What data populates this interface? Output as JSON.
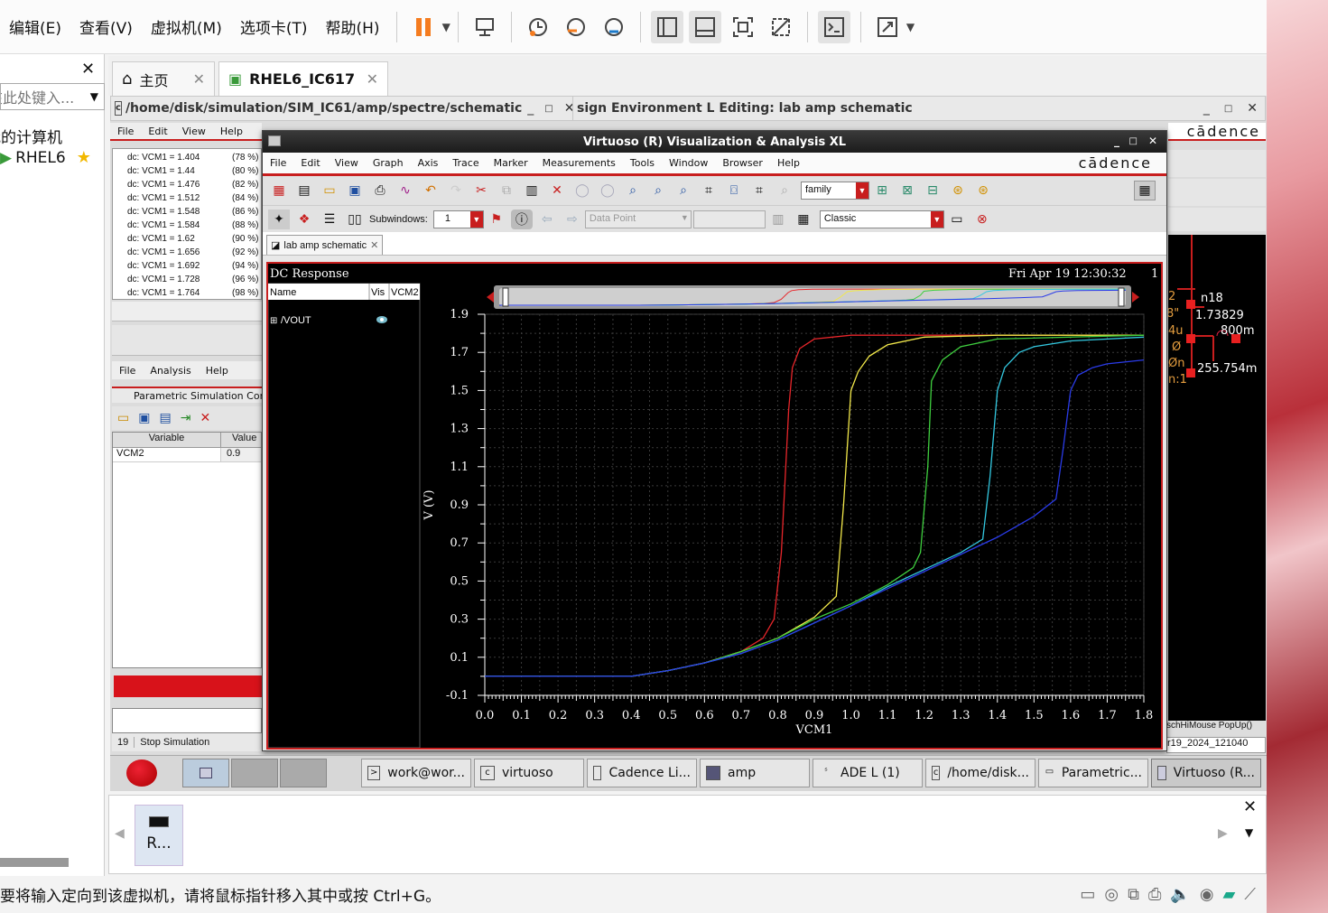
{
  "host": {
    "menu": [
      "编辑(E)",
      "查看(V)",
      "虚拟机(M)",
      "选项卡(T)",
      "帮助(H)"
    ],
    "tabs": [
      {
        "label": "主页"
      },
      {
        "label": "RHEL6_IC617"
      }
    ],
    "library": {
      "search_placeholder": "在此处键入...",
      "item1": "我的计算机",
      "item2": "RHEL6"
    },
    "status_text": "要将输入定向到该虚拟机，请将鼠标指针移入其中或按 Ctrl+G。",
    "thumb_label": "R..."
  },
  "ade": {
    "title": "/home/disk/simulation/SIM_IC61/amp/spectre/schematic",
    "menu": [
      "File",
      "Edit",
      "View",
      "Help"
    ],
    "rows": [
      {
        "label": "dc: VCM1 = 1.404",
        "pct": "(78 %)"
      },
      {
        "label": "dc: VCM1 = 1.44",
        "pct": "(80 %)"
      },
      {
        "label": "dc: VCM1 = 1.476",
        "pct": "(82 %)"
      },
      {
        "label": "dc: VCM1 = 1.512",
        "pct": "(84 %)"
      },
      {
        "label": "dc: VCM1 = 1.548",
        "pct": "(86 %)"
      },
      {
        "label": "dc: VCM1 = 1.584",
        "pct": "(88 %)"
      },
      {
        "label": "dc: VCM1 = 1.62",
        "pct": "(90 %)"
      },
      {
        "label": "dc: VCM1 = 1.656",
        "pct": "(92 %)"
      },
      {
        "label": "dc: VCM1 = 1.692",
        "pct": "(94 %)"
      },
      {
        "label": "dc: VCM1 = 1.728",
        "pct": "(96 %)"
      },
      {
        "label": "dc: VCM1 = 1.764",
        "pct": "(98 %)"
      }
    ]
  },
  "schematic": {
    "title": "sign Environment L Editing: lab amp schematic",
    "brand": "cādence",
    "labels": [
      "n18",
      "1.73829",
      "800m",
      "255.754m"
    ],
    "status1": "schHiMouse PopUp()",
    "status2": "r19_2024_121040"
  },
  "param": {
    "menu": [
      "File",
      "Analysis",
      "Help"
    ],
    "title": "Parametric Simulation Com",
    "col_variable": "Variable",
    "col_value": "Value",
    "var_name": "VCM2",
    "var_value": "0.9",
    "line_no": "19",
    "stop_label": "Stop Simulation"
  },
  "viva": {
    "title": "Virtuoso (R) Visualization & Analysis XL",
    "brand": "cādence",
    "menu": [
      "File",
      "Edit",
      "View",
      "Graph",
      "Axis",
      "Trace",
      "Marker",
      "Measurements",
      "Tools",
      "Window",
      "Browser",
      "Help"
    ],
    "family_value": "family",
    "subwindows_label": "Subwindows:",
    "subwindows_value": "1",
    "datapoint_placeholder": "Data Point",
    "classic_value": "Classic",
    "tab_label": "lab amp schematic",
    "panel_title": "DC Response",
    "timestamp": "Fri Apr 19 12:30:32",
    "page_no": "1",
    "col_name": "Name",
    "col_vis": "Vis",
    "col_vcm2": "VCM2",
    "trace_name": "/VOUT"
  },
  "taskbar": [
    {
      "label": "work@wor..."
    },
    {
      "label": "virtuoso"
    },
    {
      "label": "Cadence Li..."
    },
    {
      "label": "amp"
    },
    {
      "label": "ADE L (1)"
    },
    {
      "label": "/home/disk..."
    },
    {
      "label": "Parametric..."
    },
    {
      "label": "Virtuoso (R..."
    }
  ],
  "chart_data": {
    "type": "line",
    "title": "DC Response",
    "xlabel": "VCM1",
    "ylabel": "V (V)",
    "xlim": [
      0.0,
      1.8
    ],
    "ylim": [
      -0.1,
      1.9
    ],
    "xticks": [
      "0.0",
      "0.1",
      "0.2",
      "0.3",
      "0.4",
      "0.5",
      "0.6",
      "0.7",
      "0.8",
      "0.9",
      "1.0",
      "1.1",
      "1.2",
      "1.3",
      "1.4",
      "1.5",
      "1.6",
      "1.7",
      "1.8"
    ],
    "yticks": [
      "-0.1",
      "0.1",
      "0.3",
      "0.5",
      "0.7",
      "0.9",
      "1.1",
      "1.3",
      "1.5",
      "1.7",
      "1.9"
    ],
    "grid": true,
    "series": [
      {
        "color": "#e8262b",
        "x": [
          0.0,
          0.2,
          0.4,
          0.5,
          0.6,
          0.7,
          0.76,
          0.79,
          0.81,
          0.83,
          0.84,
          0.86,
          0.9,
          1.0,
          1.2,
          1.8
        ],
        "y": [
          0.0,
          0.0,
          0.0,
          0.03,
          0.07,
          0.13,
          0.2,
          0.3,
          0.65,
          1.4,
          1.62,
          1.72,
          1.77,
          1.79,
          1.79,
          1.79
        ]
      },
      {
        "color": "#f2e84a",
        "x": [
          0.0,
          0.4,
          0.5,
          0.6,
          0.7,
          0.8,
          0.9,
          0.96,
          0.98,
          1.0,
          1.02,
          1.05,
          1.1,
          1.2,
          1.4,
          1.8
        ],
        "y": [
          0.0,
          0.0,
          0.03,
          0.07,
          0.13,
          0.2,
          0.31,
          0.42,
          0.9,
          1.5,
          1.6,
          1.68,
          1.74,
          1.78,
          1.79,
          1.79
        ]
      },
      {
        "color": "#3fcf3f",
        "x": [
          0.0,
          0.4,
          0.5,
          0.6,
          0.7,
          0.8,
          0.9,
          1.0,
          1.1,
          1.17,
          1.19,
          1.21,
          1.22,
          1.25,
          1.3,
          1.4,
          1.8
        ],
        "y": [
          0.0,
          0.0,
          0.03,
          0.07,
          0.13,
          0.2,
          0.3,
          0.38,
          0.48,
          0.57,
          0.65,
          1.1,
          1.55,
          1.66,
          1.73,
          1.77,
          1.79
        ]
      },
      {
        "color": "#33c8e0",
        "x": [
          0.0,
          0.4,
          0.5,
          0.6,
          0.7,
          0.8,
          0.9,
          1.0,
          1.1,
          1.2,
          1.3,
          1.36,
          1.38,
          1.4,
          1.42,
          1.46,
          1.5,
          1.6,
          1.8
        ],
        "y": [
          0.0,
          0.0,
          0.03,
          0.07,
          0.12,
          0.19,
          0.28,
          0.37,
          0.47,
          0.56,
          0.65,
          0.72,
          1.05,
          1.5,
          1.62,
          1.7,
          1.73,
          1.76,
          1.78
        ]
      },
      {
        "color": "#2a3be8",
        "x": [
          0.0,
          0.4,
          0.5,
          0.6,
          0.7,
          0.8,
          0.9,
          1.0,
          1.1,
          1.2,
          1.3,
          1.4,
          1.5,
          1.56,
          1.58,
          1.6,
          1.62,
          1.66,
          1.7,
          1.8
        ],
        "y": [
          0.0,
          0.0,
          0.03,
          0.07,
          0.12,
          0.19,
          0.28,
          0.37,
          0.46,
          0.55,
          0.64,
          0.73,
          0.84,
          0.93,
          1.2,
          1.5,
          1.58,
          1.62,
          1.64,
          1.66
        ]
      }
    ]
  }
}
